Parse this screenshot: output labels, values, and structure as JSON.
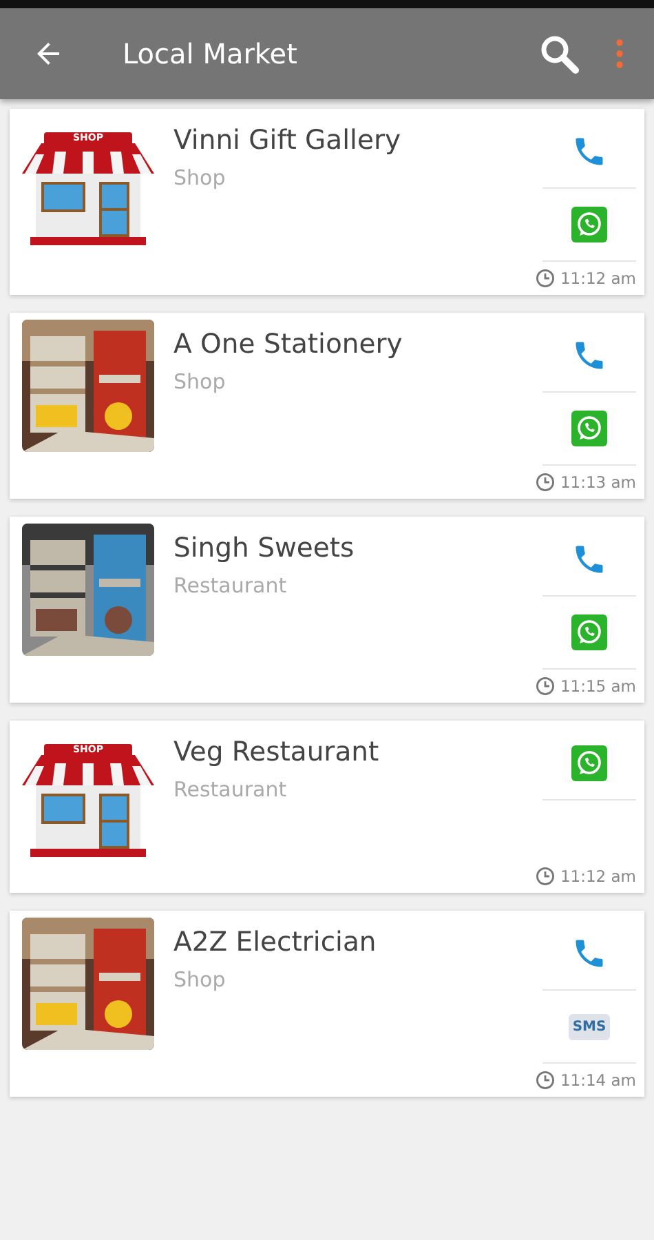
{
  "app_bar": {
    "title": "Local Market"
  },
  "listings": [
    {
      "name": "Vinni Gift Gallery",
      "category": "Shop",
      "thumbnail": {
        "kind": "shop",
        "sign": "SHOP"
      },
      "actions": [
        {
          "kind": "call"
        },
        {
          "kind": "whatsapp"
        }
      ],
      "time": "11:12 am"
    },
    {
      "name": "A One Stationery",
      "category": "Shop",
      "actions": [
        {
          "kind": "call"
        },
        {
          "kind": "whatsapp"
        }
      ],
      "time": "11:13 am"
    },
    {
      "name": "Singh Sweets",
      "category": "Restaurant",
      "actions": [
        {
          "kind": "call"
        },
        {
          "kind": "whatsapp"
        }
      ],
      "time": "11:15 am"
    },
    {
      "name": "Veg Restaurant",
      "category": "Restaurant",
      "thumbnail": {
        "kind": "shop",
        "sign": "SHOP"
      },
      "actions": [
        {
          "kind": "whatsapp"
        }
      ],
      "time": "11:12 am"
    },
    {
      "name": "A2Z Electrician",
      "category": "Shop",
      "actions": [
        {
          "kind": "call"
        },
        {
          "kind": "sms",
          "label": "SMS"
        }
      ],
      "time": "11:14 am"
    }
  ]
}
